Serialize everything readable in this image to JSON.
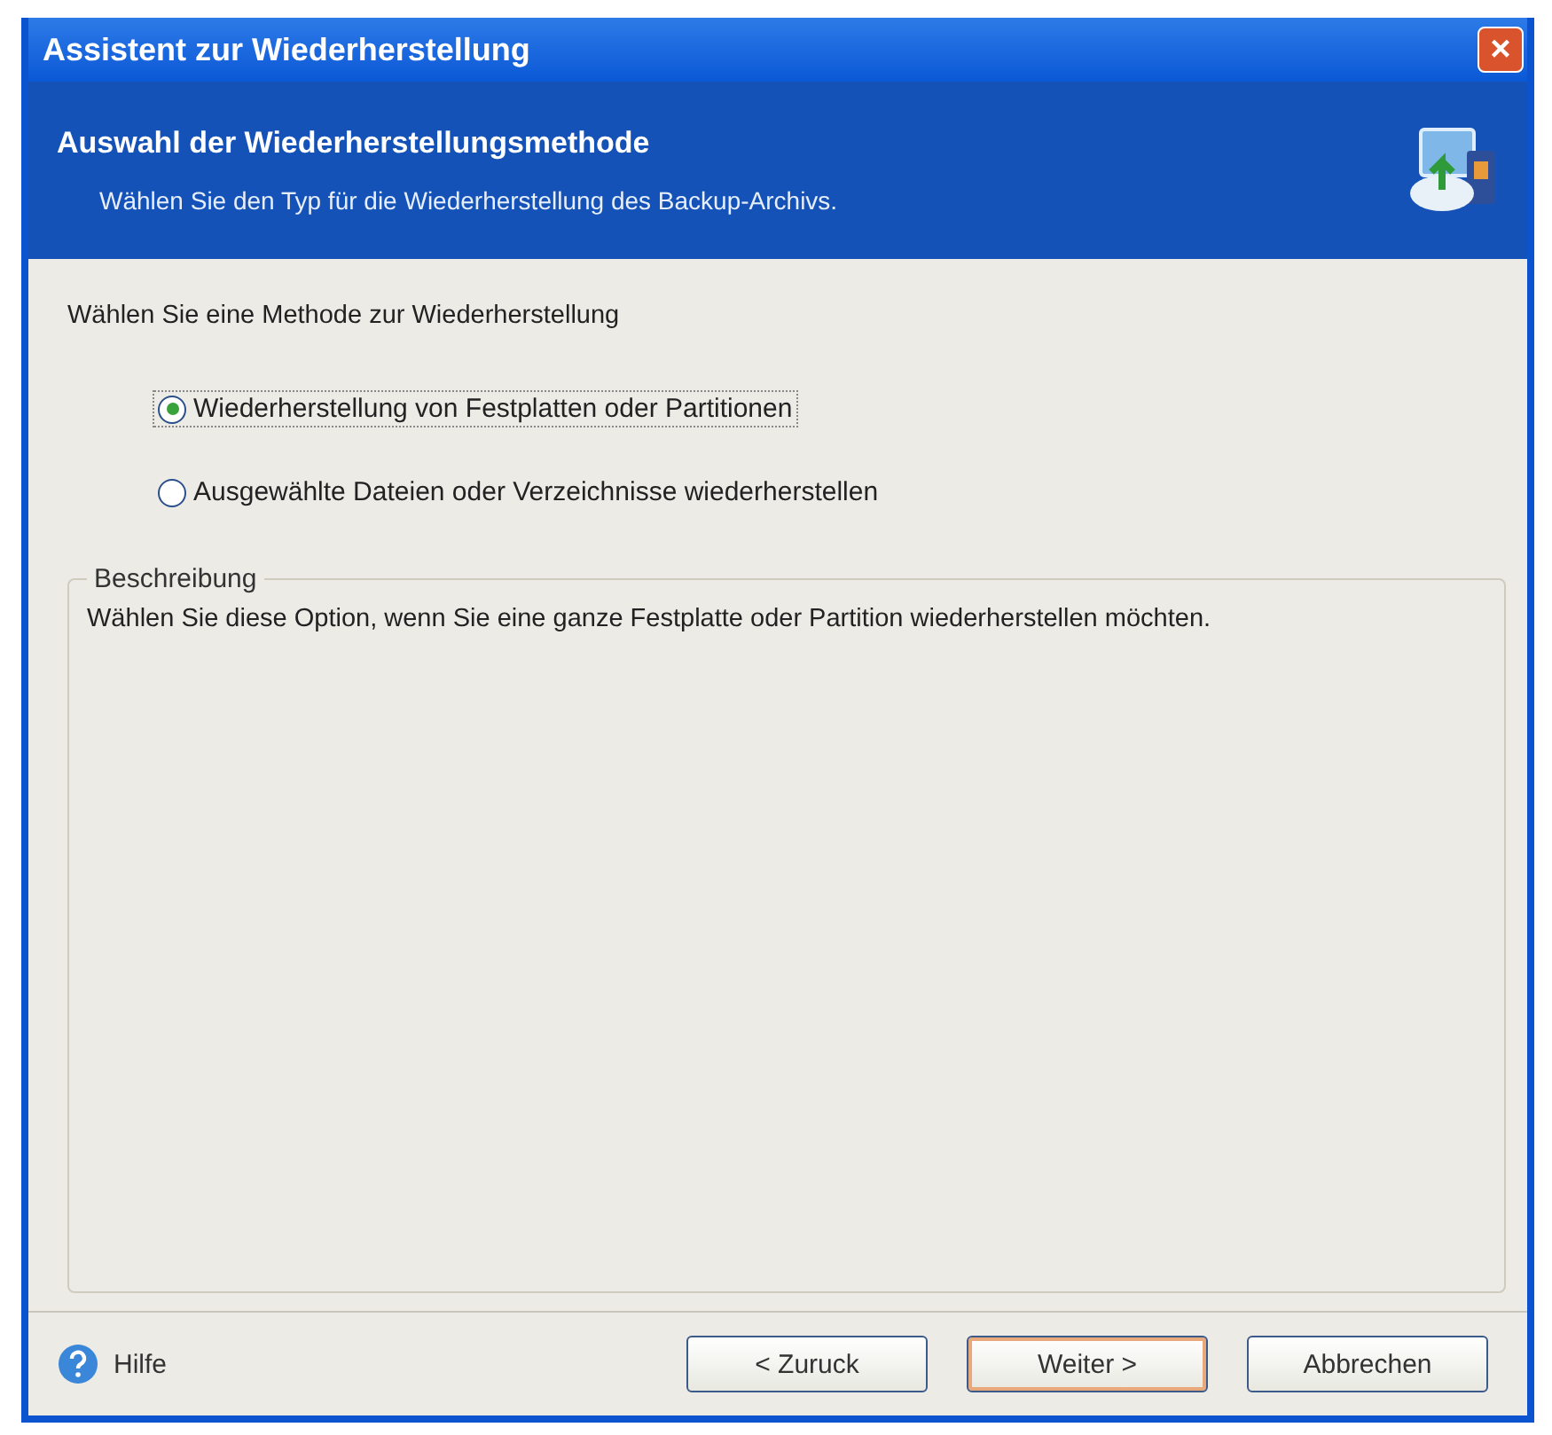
{
  "window": {
    "title": "Assistent zur Wiederherstellung",
    "close": "×"
  },
  "header": {
    "title": "Auswahl der Wiederherstellungsmethode",
    "subtitle": "Wählen Sie den Typ für die Wiederherstellung des Backup-Archivs."
  },
  "prompt": "Wählen Sie eine Methode zur Wiederherstellung",
  "options": [
    {
      "label": "Wiederherstellung von Festplatten oder Partitionen",
      "selected": true
    },
    {
      "label": "Ausgewählte Dateien oder Verzeichnisse wiederherstellen",
      "selected": false
    }
  ],
  "description": {
    "title": "Beschreibung",
    "text": "Wählen Sie diese Option, wenn Sie eine ganze Festplatte oder Partition wiederherstellen möchten."
  },
  "help": "Hilfe",
  "buttons": [
    {
      "label": "< Zuruck",
      "default": false
    },
    {
      "label": "Weiter >",
      "default": true
    },
    {
      "label": "Abbrechen",
      "default": false
    }
  ]
}
